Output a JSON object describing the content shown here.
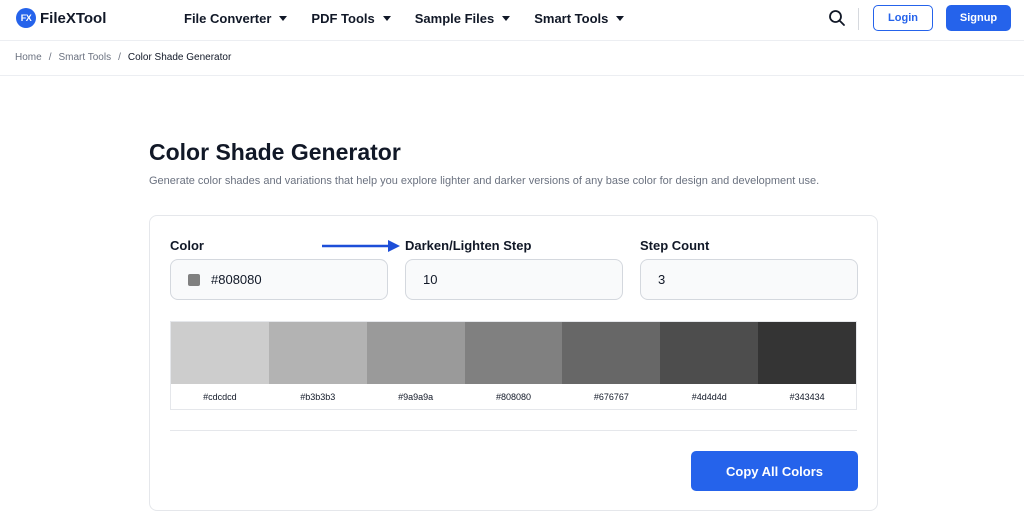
{
  "header": {
    "logo_badge": "FX",
    "logo_text": "FileXTool",
    "nav": [
      {
        "label": "File Converter"
      },
      {
        "label": "PDF Tools"
      },
      {
        "label": "Sample Files"
      },
      {
        "label": "Smart Tools"
      }
    ],
    "search_icon": "search-icon",
    "login_label": "Login",
    "signup_label": "Signup"
  },
  "breadcrumb": {
    "home": "Home",
    "section": "Smart Tools",
    "current": "Color Shade Generator",
    "separator": "/"
  },
  "main": {
    "title": "Color Shade Generator",
    "subtitle": "Generate color shades and variations that help you explore lighter and darker versions of any base color for design and development use."
  },
  "form": {
    "color_label": "Color",
    "color_value": "#808080",
    "step_label": "Darken/Lighten Step",
    "step_value": "10",
    "count_label": "Step Count",
    "count_value": "3"
  },
  "shades": [
    {
      "hex": "#cdcdcd"
    },
    {
      "hex": "#b3b3b3"
    },
    {
      "hex": "#9a9a9a"
    },
    {
      "hex": "#808080"
    },
    {
      "hex": "#676767"
    },
    {
      "hex": "#4d4d4d"
    },
    {
      "hex": "#343434"
    }
  ],
  "copy_label": "Copy All Colors",
  "colors": {
    "accent": "#2563eb",
    "annotation_arrow": "#1d4ed8"
  }
}
